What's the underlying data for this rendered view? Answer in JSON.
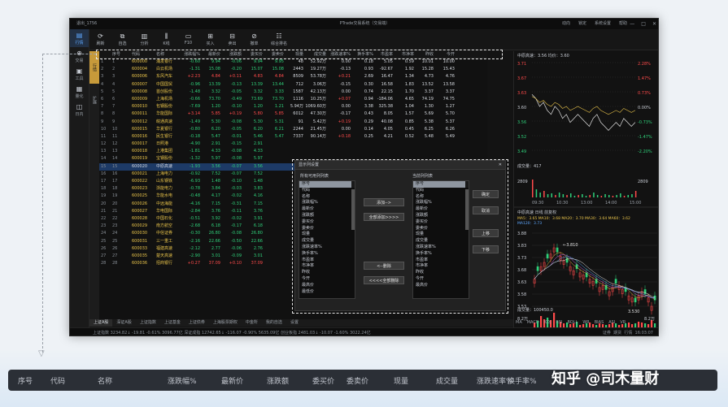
{
  "window": {
    "user": "退出_1756",
    "title": "PTrade交易系统（交易端）",
    "title_right": [
      "动向",
      "锁定",
      "系统设置",
      "帮助"
    ]
  },
  "toolbar": [
    "刷新",
    "自选",
    "分析",
    "K线",
    "F10",
    "买入",
    "卖出",
    "撤单",
    "综合排名"
  ],
  "left_nav": [
    {
      "label": "行情",
      "icon": "chart-icon"
    },
    {
      "label": "交易",
      "icon": "trade-icon"
    },
    {
      "label": "工具",
      "icon": "tool-icon"
    },
    {
      "label": "量化",
      "icon": "quant-icon"
    },
    {
      "label": "日内",
      "icon": "intraday-icon"
    }
  ],
  "vtabs": [
    "行情",
    "扩展"
  ],
  "grid": {
    "headers": [
      "",
      "序号",
      "代码",
      "名称",
      "涨跌幅%",
      "最新价",
      "涨跌额",
      "委买价",
      "委卖价",
      "现量",
      "成交量",
      "涨跌速率%",
      "换手率%",
      "市盈率",
      "市净率",
      "昨收",
      "今开",
      ""
    ],
    "rows": [
      [
        "1",
        "1",
        "600000",
        "浦发银行",
        "-0.60",
        "9.94",
        "-0.06",
        "9.94",
        "9.95",
        "48",
        "52.92万",
        "0.00",
        "0.18",
        "5.05",
        "0.59",
        "10.01",
        "10.00"
      ],
      [
        "2",
        "2",
        "600004",
        "白云机场",
        "-1.31",
        "15.08",
        "-0.20",
        "15.07",
        "15.08",
        "2443",
        "19.27万",
        "-0.13",
        "0.93",
        "-92.67",
        "1.92",
        "15.28",
        "15.43"
      ],
      [
        "3",
        "3",
        "600006",
        "东风汽车",
        "+2.23",
        "4.84",
        "+0.11",
        "4.83",
        "4.84",
        "8509",
        "53.78万",
        "+0.21",
        "2.69",
        "16.47",
        "1.34",
        "4.73",
        "4.76"
      ],
      [
        "4",
        "4",
        "600007",
        "中国国贸",
        "-0.96",
        "13.39",
        "-0.13",
        "13.39",
        "13.44",
        "712",
        "3.06万",
        "-0.15",
        "0.30",
        "16.58",
        "1.83",
        "13.52",
        "13.58"
      ],
      [
        "5",
        "5",
        "600008",
        "首创股份",
        "-1.48",
        "3.32",
        "-0.05",
        "3.32",
        "3.33",
        "1587",
        "42.13万",
        "0.00",
        "0.74",
        "22.15",
        "1.70",
        "3.37",
        "3.37"
      ],
      [
        "6",
        "6",
        "600009",
        "上海机场",
        "-0.66",
        "73.70",
        "-0.49",
        "73.69",
        "73.70",
        "1116",
        "10.25万",
        "+0.07",
        "0.94",
        "-184.06",
        "4.65",
        "74.19",
        "74.75"
      ],
      [
        "7",
        "7",
        "600010",
        "包钢股份",
        "-7.69",
        "1.20",
        "-0.10",
        "1.20",
        "1.21",
        "5.94万",
        "1069.60万",
        "0.00",
        "3.38",
        "325.38",
        "1.04",
        "1.30",
        "1.27"
      ],
      [
        "8",
        "8",
        "600011",
        "华能国际",
        "+3.14",
        "5.85",
        "+0.19",
        "5.80",
        "5.85",
        "6012",
        "47.30万",
        "-0.17",
        "0.43",
        "8.05",
        "1.57",
        "5.69",
        "5.70"
      ],
      [
        "9",
        "9",
        "600012",
        "皖通高速",
        "-1.49",
        "5.30",
        "-0.08",
        "5.30",
        "5.31",
        "91",
        "5.42万",
        "+0.19",
        "0.29",
        "40.08",
        "0.85",
        "5.38",
        "5.37"
      ],
      [
        "10",
        "10",
        "600015",
        "华夏银行",
        "-0.80",
        "6.20",
        "-0.05",
        "6.20",
        "6.21",
        "2244",
        "21.45万",
        "0.00",
        "0.14",
        "4.05",
        "0.45",
        "6.25",
        "6.26"
      ],
      [
        "11",
        "11",
        "600016",
        "民生银行",
        "-0.18",
        "5.47",
        "-0.01",
        "5.46",
        "5.47",
        "7337",
        "90.14万",
        "+0.18",
        "0.25",
        "4.21",
        "0.52",
        "5.48",
        "5.49"
      ],
      [
        "12",
        "12",
        "600017",
        "日照港",
        "-4.90",
        "2.91",
        "-0.15",
        "2.91",
        "",
        "",
        "",
        "",
        "",
        "",
        "",
        "",
        ""
      ],
      [
        "13",
        "13",
        "600018",
        "上港集团",
        "-1.81",
        "4.33",
        "-0.08",
        "4.33",
        "",
        "",
        "",
        "",
        "",
        "",
        "",
        "",
        ""
      ],
      [
        "14",
        "14",
        "600019",
        "宝钢股份",
        "-1.32",
        "5.97",
        "-0.08",
        "5.97",
        "",
        "",
        "",
        "",
        "",
        "",
        "",
        "",
        ""
      ],
      [
        "15",
        "15",
        "600020",
        "中原高速",
        "-1.93",
        "3.56",
        "-0.07",
        "3.56",
        "",
        "",
        "",
        "",
        "",
        "",
        "",
        "",
        ""
      ],
      [
        "16",
        "16",
        "600021",
        "上海电力",
        "-0.92",
        "7.52",
        "-0.07",
        "7.52",
        "",
        "",
        "",
        "",
        "",
        "",
        "",
        "",
        ""
      ],
      [
        "17",
        "17",
        "600022",
        "山东钢铁",
        "-6.93",
        "1.48",
        "-0.10",
        "1.48",
        "",
        "",
        "",
        "",
        "",
        "",
        "",
        "",
        ""
      ],
      [
        "18",
        "18",
        "600023",
        "浙能电力",
        "-0.78",
        "3.84",
        "-0.03",
        "3.83",
        "",
        "",
        "",
        "",
        "",
        "",
        "",
        "",
        ""
      ],
      [
        "19",
        "19",
        "600025",
        "华能水电",
        "-0.48",
        "4.17",
        "-0.02",
        "4.16",
        "",
        "",
        "",
        "",
        "",
        "",
        "",
        "",
        ""
      ],
      [
        "20",
        "20",
        "600026",
        "中远海能",
        "-4.16",
        "7.15",
        "-0.31",
        "7.15",
        "",
        "",
        "",
        "",
        "",
        "",
        "",
        "",
        ""
      ],
      [
        "21",
        "21",
        "600027",
        "华电国际",
        "-2.84",
        "3.76",
        "-0.11",
        "3.76",
        "",
        "",
        "",
        "",
        "",
        "",
        "",
        "",
        ""
      ],
      [
        "22",
        "22",
        "600028",
        "中国石化",
        "-0.51",
        "3.92",
        "-0.02",
        "3.91",
        "",
        "",
        "",
        "",
        "",
        "",
        "",
        "",
        ""
      ],
      [
        "23",
        "23",
        "600029",
        "南方航空",
        "-2.68",
        "6.18",
        "-0.17",
        "6.18",
        "",
        "",
        "",
        "",
        "",
        "",
        "",
        "",
        ""
      ],
      [
        "24",
        "24",
        "600030",
        "中信证券",
        "-0.30",
        "26.80",
        "-0.08",
        "26.80",
        "",
        "",
        "",
        "",
        "",
        "",
        "",
        "",
        ""
      ],
      [
        "25",
        "25",
        "600031",
        "三一重工",
        "-2.16",
        "22.66",
        "-0.50",
        "22.66",
        "",
        "",
        "",
        "",
        "",
        "",
        "",
        "",
        ""
      ],
      [
        "26",
        "26",
        "600033",
        "福建高速",
        "-2.12",
        "2.77",
        "-0.06",
        "2.76",
        "",
        "",
        "",
        "",
        "",
        "",
        "",
        "",
        ""
      ],
      [
        "27",
        "27",
        "600035",
        "楚天高速",
        "-2.90",
        "3.01",
        "-0.09",
        "3.01",
        "",
        "",
        "",
        "",
        "",
        "",
        "",
        "",
        ""
      ],
      [
        "28",
        "28",
        "600036",
        "招商银行",
        "+0.27",
        "37.09",
        "+0.10",
        "37.09",
        "",
        "",
        "",
        "",
        "",
        "",
        "",
        "",
        ""
      ]
    ]
  },
  "dialog": {
    "title": "显示列设置",
    "left_label": "所有可用列列表",
    "right_label": "当前列列表",
    "available": [
      "序号",
      "代码",
      "名称",
      "涨跌幅%",
      "最新价",
      "涨跌额",
      "委买价",
      "委卖价",
      "现量",
      "成交量",
      "涨跌速率%",
      "换手率%",
      "市盈率",
      "市净率",
      "昨收",
      "今开",
      "最高价",
      "最低价"
    ],
    "current": [
      "序号",
      "代码",
      "名称",
      "涨跌幅%",
      "最新价",
      "涨跌额",
      "委买价",
      "委卖价",
      "现量",
      "成交量",
      "涨跌速率%",
      "换手率%",
      "市盈率",
      "市净率",
      "昨收",
      "今开",
      "最高价"
    ],
    "buttons": {
      "add": "添加-->",
      "add_all": "全部添加>>>>",
      "remove": "<--删除",
      "remove_all": "<<<<全部删除",
      "ok": "确定",
      "cancel": "取消",
      "up": "上移",
      "down": "下移"
    }
  },
  "right_panel": {
    "stock_line": "中原高速：3.56 均价：3.60",
    "price_ticks_left": [
      "3.71",
      "3.67",
      "3.63",
      "3.60",
      "3.56",
      "3.52",
      "3.49"
    ],
    "pct_ticks_right": [
      "2.28%",
      "1.47%",
      "0.73%",
      "0.00%",
      "-0.73%",
      "-1.47%",
      "-2.20%"
    ],
    "volume_label": "成交量：417",
    "vol_ticks": [
      "2809",
      "2809"
    ],
    "time_ticks": [
      "09:30",
      "10:30",
      "13:00",
      "14:00",
      "15:00"
    ],
    "kline_header": "中原高速 日线 前复权",
    "ma_line1": "MA5：3.65  MA10：3.68  MA20：3.70  MA30：3.64  MA60：3.62",
    "ma_line2": "MA120：3.73",
    "k_ticks": [
      "3.88",
      "3.83",
      "3.73",
      "3.68",
      "3.63",
      "3.58",
      "3.53"
    ],
    "k_annotation_high": "3.810",
    "k_annotation_low": "3.530",
    "k_vol_label": "成交量：100450.0",
    "k_vol_ticks": [
      "8.2万",
      "8.2万"
    ],
    "k_dates": [
      "2020/07/28",
      "2020/09/25"
    ],
    "indicator_tabs": [
      "MA",
      "MACD",
      "KDJ",
      "RSI",
      "BOLL",
      "WR",
      "BIAS",
      "ASI",
      "VR"
    ],
    "status_right": [
      "证券",
      "期货",
      "行情",
      "16:03:07"
    ]
  },
  "bottom_tabs": [
    "上证A股",
    "深证A股",
    "上证指数",
    "上证基金",
    "上证债券",
    "上海股票期权",
    "中金所",
    "我的自选",
    "设置"
  ],
  "statusbar": "上证指数 3234.82↓ -19.81 -0.61%  3096.77亿  深证成指 12742.65↓ -116.07 -0.90%  5635.09亿  创业板指 2481.03↓ -10.07 -1.60%  3022.24亿",
  "banner_columns": [
    "序号",
    "代码",
    "名称",
    "涨跌幅%",
    "最新价",
    "涨跌额",
    "委买价",
    "委卖价",
    "现量",
    "成交量",
    "涨跌速率%",
    "换手率%"
  ],
  "watermark": "知乎 @司木量财",
  "colors": {
    "up": "#ff4b4b",
    "down": "#2fd07a",
    "accent": "#c79a3a",
    "select": "#1d3a66"
  }
}
